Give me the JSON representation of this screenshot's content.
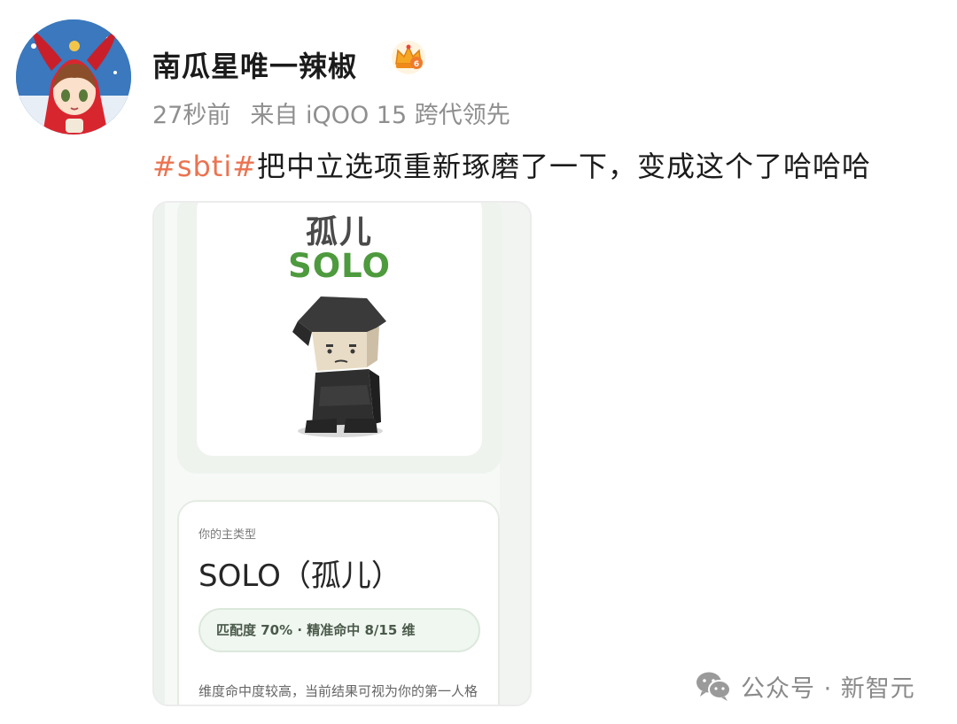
{
  "post": {
    "username": "南瓜星唯一辣椒",
    "badge_icon": "crown-vip-icon",
    "time": "27秒前",
    "source": "来自 iQOO 15 跨代领先",
    "hashtag": "#sbti#",
    "text": "把中立选项重新琢磨了一下，变成这个了哈哈哈"
  },
  "image": {
    "type_cn": "孤儿",
    "type_en": "SOLO",
    "result_label": "你的主类型",
    "result_title": "SOLO（孤儿）",
    "match": "匹配度 70% · 精准命中 8/15 维",
    "desc": "维度命中度较高，当前结果可视为你的第一人格画像。"
  },
  "watermark": {
    "text": "公众号 · 新智元",
    "icon": "wechat-icon"
  },
  "colors": {
    "hashtag": "#eb7350",
    "solo_green": "#4e9a3e",
    "meta_gray": "#8f8f8f"
  }
}
